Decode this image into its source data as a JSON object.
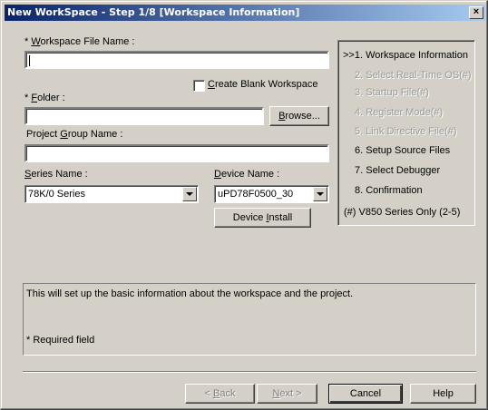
{
  "window": {
    "title": "New WorkSpace - Step 1/8 [Workspace Information]",
    "close": "×"
  },
  "form": {
    "workspace_label_prefix": "* ",
    "workspace_label_key": "W",
    "workspace_label_rest": "orkspace File Name :",
    "workspace_value": "",
    "create_blank_key": "C",
    "create_blank_rest": "reate Blank Workspace",
    "folder_label_prefix": "* ",
    "folder_label_key": "F",
    "folder_label_rest": "older :",
    "folder_value": "",
    "browse_key": "B",
    "browse_rest": "rowse...",
    "project_group_pre": "Project ",
    "project_group_key": "G",
    "project_group_rest": "roup Name :",
    "project_group_value": "",
    "series_label_key": "S",
    "series_label_rest": "eries Name :",
    "series_value": "78K/0 Series",
    "device_label_key": "D",
    "device_label_rest": "evice Name :",
    "device_value": "uPD78F0500_30",
    "device_install_pre": "Device ",
    "device_install_key": "I",
    "device_install_rest": "nstall"
  },
  "steps": [
    {
      "label": ">>1. Workspace Information"
    },
    {
      "label": "2. Select Real-Time OS(#)"
    },
    {
      "label": "3. Startup File(#)"
    },
    {
      "label": "4. Register Mode(#)"
    },
    {
      "label": "5. Link Directive File(#)"
    },
    {
      "label": "6. Setup Source Files"
    },
    {
      "label": "7. Select Debugger"
    },
    {
      "label": "8. Confirmation"
    },
    {
      "label": "(#) V850 Series Only (2-5)"
    }
  ],
  "info": {
    "description": "This will set up the basic information about the workspace and the project.",
    "required_note": "* Required field"
  },
  "buttons": {
    "back_pre": "< ",
    "back_key": "B",
    "back_rest": "ack",
    "next_key": "N",
    "next_rest": "ext >",
    "cancel": "Cancel",
    "help": "Help"
  }
}
